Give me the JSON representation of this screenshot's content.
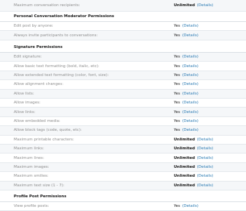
{
  "details_label": "(Details)",
  "rows_top": [
    {
      "label": "Maximum conversation recipients:",
      "value": "Unlimited"
    }
  ],
  "section1": {
    "title": "Personal Conversation Moderator Permissions",
    "rows": [
      {
        "label": "Edit post by anyone:",
        "value": "Yes"
      },
      {
        "label": "Always invite participants to conversations:",
        "value": "Yes"
      }
    ]
  },
  "section2": {
    "title": "Signature Permissions",
    "rows": [
      {
        "label": "Edit signature:",
        "value": "Yes"
      },
      {
        "label": "Allow basic text formatting (bold, italic, etc):",
        "value": "Yes"
      },
      {
        "label": "Allow extended text formatting (color, font, size):",
        "value": "Yes"
      },
      {
        "label": "Allow alignment changes:",
        "value": "Yes"
      },
      {
        "label": "Allow lists:",
        "value": "Yes"
      },
      {
        "label": "Allow images:",
        "value": "Yes"
      },
      {
        "label": "Allow links:",
        "value": "Yes"
      },
      {
        "label": "Allow embedded media:",
        "value": "Yes"
      },
      {
        "label": "Allow block tags (code, quote, etc):",
        "value": "Yes"
      },
      {
        "label": "Maximum printable characters:",
        "value": "Unlimited"
      },
      {
        "label": "Maximum links:",
        "value": "Unlimited"
      },
      {
        "label": "Maximum lines:",
        "value": "Unlimited"
      },
      {
        "label": "Maximum images:",
        "value": "Unlimited"
      },
      {
        "label": "Maximum smilies:",
        "value": "Unlimited"
      },
      {
        "label": "Maximum text size (1 - 7):",
        "value": "Unlimited"
      }
    ]
  },
  "section3": {
    "title": "Profile Post Permissions",
    "rows": [
      {
        "label": "View profile posts:",
        "value": "Yes"
      }
    ]
  }
}
